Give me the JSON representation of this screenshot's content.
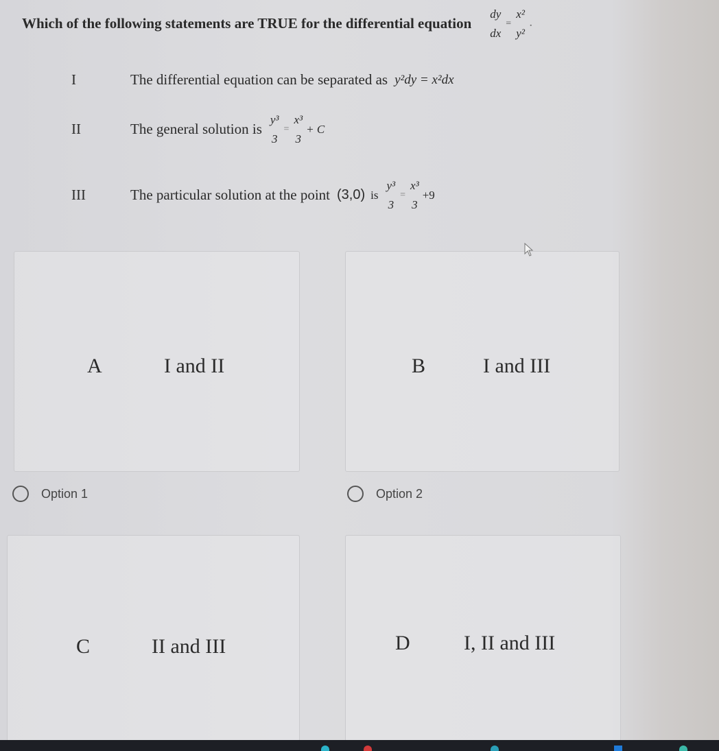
{
  "question": {
    "text": "Which of the following statements are TRUE for the differential equation",
    "equation": {
      "lhs_num": "dy",
      "lhs_den": "dx",
      "rhs_num": "x²",
      "rhs_den": "y²",
      "equals": "=",
      "trailing": "."
    }
  },
  "statements": [
    {
      "numeral": "I",
      "text": "The differential equation can be separated as",
      "math": "y²dy = x²dx"
    },
    {
      "numeral": "II",
      "text": "The general solution is",
      "lhs_num": "y³",
      "lhs_den": "3",
      "rhs_num": "x³",
      "rhs_den": "3",
      "rhs_tail": "+ C",
      "equals": "="
    },
    {
      "numeral": "III",
      "text": "The particular solution at the point",
      "point": "(3,0)",
      "is": "is",
      "lhs_num": "y³",
      "lhs_den": "3",
      "rhs_num": "x³",
      "rhs_den": "3",
      "rhs_tail": "+9",
      "equals": "="
    }
  ],
  "choices": [
    {
      "letter": "A",
      "value": "I and II",
      "radio_label": "Option 1"
    },
    {
      "letter": "B",
      "value": "I and III",
      "radio_label": "Option 2"
    },
    {
      "letter": "C",
      "value": "II and III"
    },
    {
      "letter": "D",
      "value": "I, II and III"
    }
  ]
}
